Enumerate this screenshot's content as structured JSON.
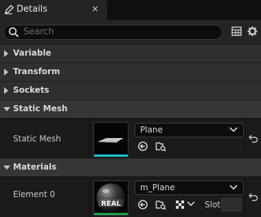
{
  "tab": {
    "title": "Details",
    "close": "×"
  },
  "search": {
    "placeholder": "Search"
  },
  "sections": {
    "variable": "Variable",
    "transform": "Transform",
    "sockets": "Sockets",
    "static_mesh": "Static Mesh",
    "materials": "Materials"
  },
  "static_mesh": {
    "label": "Static Mesh",
    "value": "Plane",
    "thumb_bar_color": "#19c7d4"
  },
  "materials": {
    "label": "Element 0",
    "value": "m_Plane",
    "slot_label": "Slot",
    "thumb_bar_color": "#1ea34a",
    "thumb_text": "REAL"
  },
  "icons": {
    "tab": "pencil-icon",
    "close": "close-icon",
    "search": "search-icon",
    "table": "table-view-icon",
    "settings": "gear-icon",
    "browse": "browse-arrow-icon",
    "find": "find-in-browser-icon",
    "reset": "reset-to-default-icon",
    "checker": "checker-icon"
  },
  "colors": {
    "background": "#151515",
    "section": "#2f2f2f",
    "row": "#1b1b1b",
    "accent_cyan": "#19c7d4",
    "accent_green": "#1ea34a"
  }
}
